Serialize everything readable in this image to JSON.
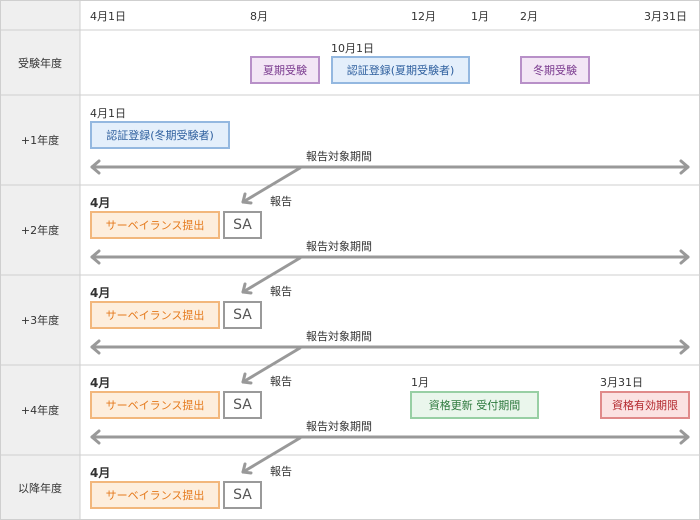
{
  "timeline": {
    "ticks": [
      "4月1日",
      "8月",
      "12月",
      "1月",
      "2月",
      "3月31日"
    ]
  },
  "rows": [
    {
      "label": "受験年度"
    },
    {
      "label": "+1年度"
    },
    {
      "label": "+2年度"
    },
    {
      "label": "+3年度"
    },
    {
      "label": "+4年度"
    },
    {
      "label": "以降年度"
    }
  ],
  "exam_year": {
    "summer_exam": "夏期受験",
    "date_oct": "10月1日",
    "cert_summer": "認証登録(夏期受験者)",
    "winter_exam": "冬期受験"
  },
  "year1": {
    "date": "4月1日",
    "cert_winter": "認証登録(冬期受験者)",
    "period": "報告対象期間"
  },
  "year2": {
    "month": "4月",
    "surveillance": "サーベイランス提出",
    "sa": "SA",
    "report": "報告",
    "period": "報告対象期間"
  },
  "year3": {
    "month": "4月",
    "surveillance": "サーベイランス提出",
    "sa": "SA",
    "report": "報告",
    "period": "報告対象期間"
  },
  "year4": {
    "month": "4月",
    "surveillance": "サーベイランス提出",
    "sa": "SA",
    "report": "報告",
    "jan": "1月",
    "renewal": "資格更新 受付期間",
    "mar31": "3月31日",
    "expiry": "資格有効期限",
    "period": "報告対象期間"
  },
  "later": {
    "month": "4月",
    "surveillance": "サーベイランス提出",
    "sa": "SA",
    "report": "報告"
  }
}
